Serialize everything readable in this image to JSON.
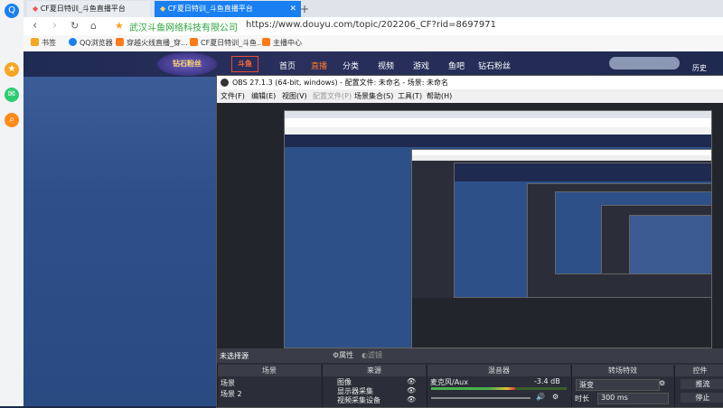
{
  "browser": {
    "tabs": [
      {
        "label": "CF夏日特训_斗鱼直播平台",
        "active": false
      },
      {
        "label": "CF夏日特训_斗鱼直播平台",
        "active": true
      }
    ],
    "new_tab": "+",
    "site_owner": "武汉斗鱼网络科技有限公司",
    "url": "https://www.douyu.com/topic/202206_CF?rid=8697971",
    "bookmarks": [
      "书签",
      "QQ浏览器",
      "穿越火线直播_穿...",
      "CF夏日特训_斗鱼...",
      "主播中心"
    ]
  },
  "douyu": {
    "logo": "斗鱼",
    "badge": "钻石粉丝",
    "nav": [
      "首页",
      "直播",
      "分类",
      "视频",
      "游戏",
      "鱼吧",
      "钻石粉丝"
    ],
    "history": "历史",
    "search_placeholder": ""
  },
  "obs": {
    "title": "OBS 27.1.3 (64-bit, windows) - 配置文件: 未命名 - 场景: 未命名",
    "menu": [
      "文件(F)",
      "编辑(E)",
      "视图(V)",
      "配置文件(P)",
      "场景集合(S)",
      "工具(T)",
      "帮助(H)"
    ],
    "status_left": "未选择源",
    "properties": "属性",
    "filters": "滤镜",
    "scenes_header": "场景",
    "scenes": [
      "场景",
      "场景 2"
    ],
    "sources_header": "来源",
    "sources": [
      "图像",
      "显示器采集",
      "视频采集设备"
    ],
    "mixer_header": "混音器",
    "mixer_track": "麦克风/Aux",
    "mixer_db": "-3.4 dB",
    "mixer_level": 0.62,
    "transitions_header": "转场特效",
    "transition_value": "渐变",
    "duration_label": "时长",
    "duration_value": "300 ms",
    "controls_header": "控件",
    "control_1": "推流",
    "control_2": "停止"
  },
  "colors": {
    "accent": "#1a7ff0",
    "douyu_orange": "#ff6a00",
    "obs_dark": "#2b2e38"
  }
}
